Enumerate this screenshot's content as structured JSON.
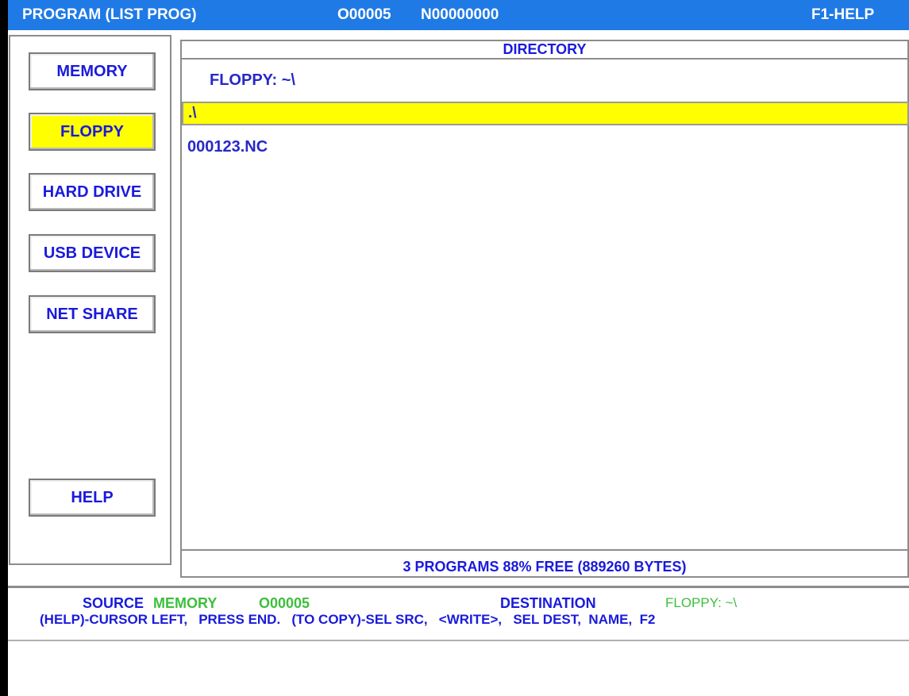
{
  "title_bar": {
    "mode": "PROGRAM (LIST PROG)",
    "program": "O00005",
    "sequence": "N00000000",
    "help_hint": "F1-HELP"
  },
  "softkeys": [
    {
      "label": "MEMORY",
      "active": false
    },
    {
      "label": "FLOPPY",
      "active": true
    },
    {
      "label": "HARD DRIVE",
      "active": false
    },
    {
      "label": "USB DEVICE",
      "active": false
    },
    {
      "label": "NET SHARE",
      "active": false
    }
  ],
  "help_button": "HELP",
  "directory": {
    "header": "DIRECTORY",
    "path": "FLOPPY: ~\\",
    "selected_entry": ".\\",
    "files": [
      "000123.NC"
    ],
    "status": "3 PROGRAMS 88% FREE (889260 BYTES)"
  },
  "info": {
    "source_label": "SOURCE",
    "source_device": "MEMORY",
    "source_program": "O00005",
    "destination_label": "DESTINATION",
    "destination_path": "FLOPPY: ~\\",
    "instructions": "(HELP)-CURSOR LEFT,   PRESS END.   (TO COPY)-SEL SRC,   <WRITE>,   SEL DEST,  NAME,  F2"
  },
  "colors": {
    "title_bar": "#1f7ae6",
    "highlight": "#ffff00",
    "text_blue": "#1a1adc",
    "text_green": "#3cbf3c"
  }
}
